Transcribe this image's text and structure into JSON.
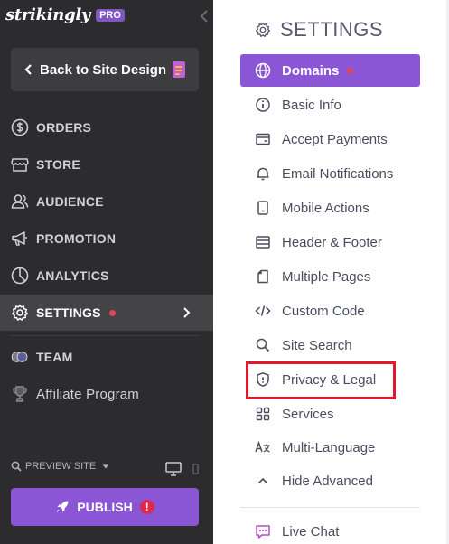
{
  "brand": {
    "logo_text": "strikingly",
    "badge": "PRO"
  },
  "sidebar": {
    "back_label": "Back to Site Design",
    "items": [
      {
        "label": "ORDERS",
        "icon": "dollar-circle-icon"
      },
      {
        "label": "STORE",
        "icon": "storefront-icon"
      },
      {
        "label": "AUDIENCE",
        "icon": "people-icon"
      },
      {
        "label": "PROMOTION",
        "icon": "megaphone-icon"
      },
      {
        "label": "ANALYTICS",
        "icon": "pie-chart-icon"
      },
      {
        "label": "SETTINGS",
        "icon": "gear-icon",
        "active": true
      },
      {
        "label": "TEAM",
        "icon": "team-avatars-icon"
      },
      {
        "label": "Affiliate Program",
        "icon": "trophy-icon"
      }
    ],
    "preview_label": "PREVIEW SITE",
    "publish_label": "PUBLISH",
    "publish_alert": "!"
  },
  "settings": {
    "title": "SETTINGS",
    "items": [
      {
        "label": "Domains",
        "icon": "globe-icon",
        "active": true
      },
      {
        "label": "Basic Info",
        "icon": "info-icon"
      },
      {
        "label": "Accept Payments",
        "icon": "credit-card-icon"
      },
      {
        "label": "Email Notifications",
        "icon": "bell-icon"
      },
      {
        "label": "Mobile Actions",
        "icon": "mobile-icon"
      },
      {
        "label": "Header & Footer",
        "icon": "header-footer-icon"
      },
      {
        "label": "Multiple Pages",
        "icon": "pages-icon"
      },
      {
        "label": "Custom Code",
        "icon": "code-icon"
      },
      {
        "label": "Site Search",
        "icon": "search-icon"
      },
      {
        "label": "Privacy & Legal",
        "icon": "shield-icon"
      },
      {
        "label": "Services",
        "icon": "grid-icon"
      },
      {
        "label": "Multi-Language",
        "icon": "translate-icon"
      },
      {
        "label": "Hide Advanced",
        "icon": "chevron-up-icon"
      },
      {
        "label": "Live Chat",
        "icon": "chat-icon"
      }
    ]
  },
  "colors": {
    "accent": "#8a56d6",
    "sidebar_bg": "#2c2c2e",
    "alert": "#e0294a",
    "highlight_box": "#e0192c"
  }
}
